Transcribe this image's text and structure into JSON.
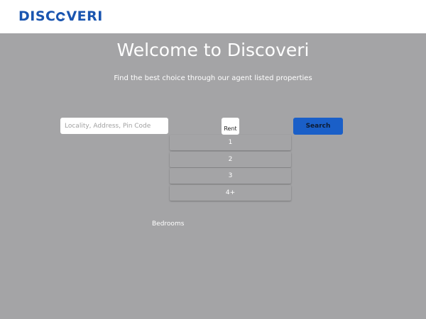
{
  "header": {
    "logo": {
      "before": "DISC",
      "after": "VERI"
    }
  },
  "hero": {
    "title": "Welcome to Discoveri",
    "subtitle": "Find the best choice through our agent listed properties"
  },
  "search": {
    "placeholder": "Locality, Address, Pin Code",
    "value": "",
    "type_label": "Rent",
    "button_label": "Search"
  },
  "bedrooms": {
    "label": "Bedrooms",
    "options": [
      "1",
      "2",
      "3",
      "4+"
    ]
  },
  "colors": {
    "brand": "#1a55b0",
    "button": "#1a5fc8",
    "overlay": "#a4a4a6"
  }
}
